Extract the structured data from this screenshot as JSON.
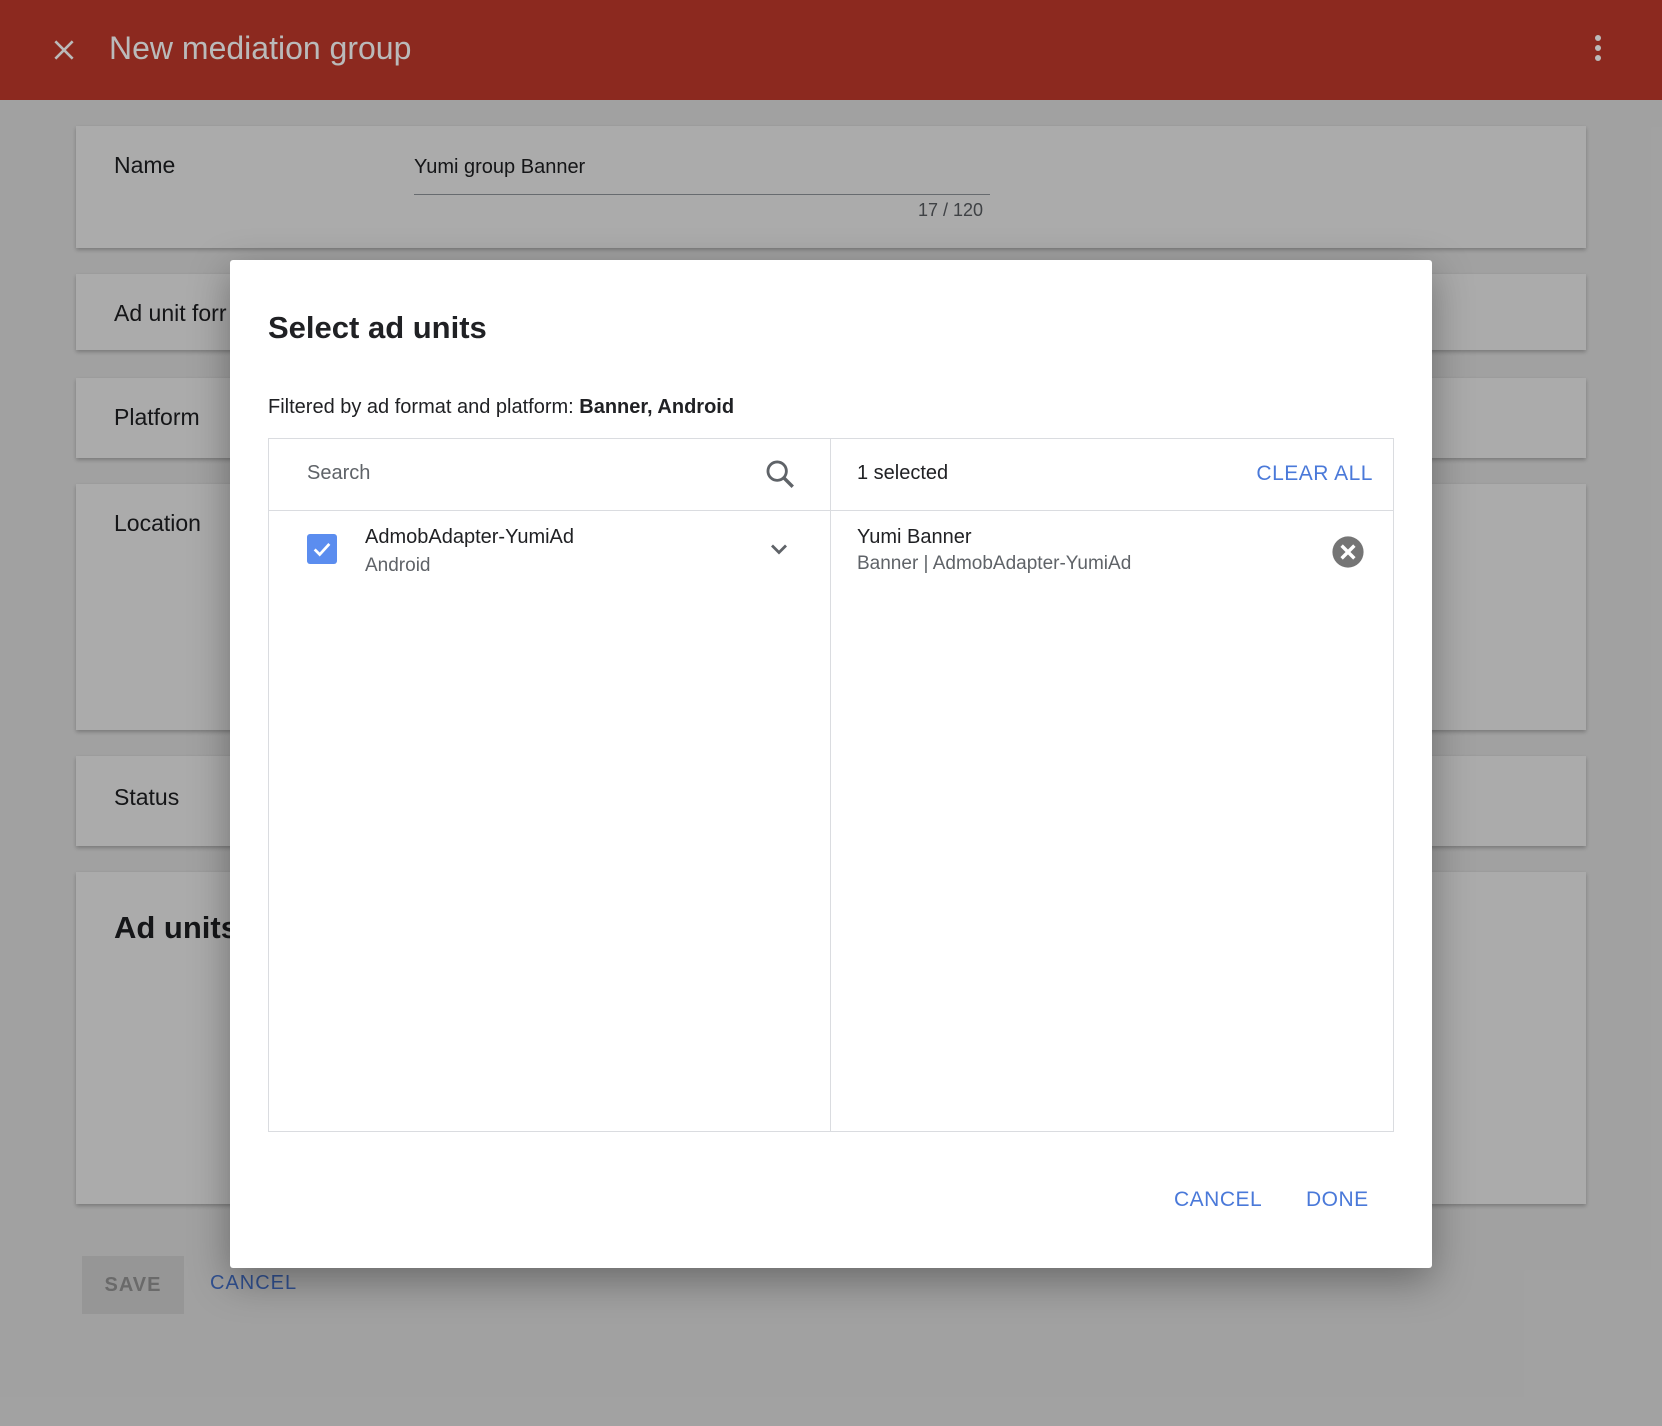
{
  "app": {
    "title": "New mediation group",
    "brand_color": "#c0392b",
    "close_icon": "close-icon",
    "more_icon": "more-vert-icon"
  },
  "form": {
    "name_label": "Name",
    "name_value": "Yumi group Banner",
    "name_counter": "17 / 120",
    "ad_unit_format_label": "Ad unit forr",
    "platform_label": "Platform",
    "location_label": "Location",
    "status_label": "Status",
    "ad_units_heading": "Ad units",
    "save_label": "SAVE",
    "cancel_label": "CANCEL"
  },
  "dialog": {
    "title": "Select ad units",
    "filter_prefix": "Filtered by ad format and platform: ",
    "filter_value": "Banner, Android",
    "search_placeholder": "Search",
    "selected_count": "1 selected",
    "clear_all_label": "CLEAR ALL",
    "available_items": [
      {
        "title": "AdmobAdapter-YumiAd",
        "subtitle": "Android",
        "checked": true
      }
    ],
    "selected_items": [
      {
        "title": "Yumi Banner",
        "subtitle": "Banner | AdmobAdapter-YumiAd"
      }
    ],
    "cancel_label": "CANCEL",
    "done_label": "DONE",
    "accent_color": "#4a79d9",
    "checkbox_color": "#5b8def"
  }
}
